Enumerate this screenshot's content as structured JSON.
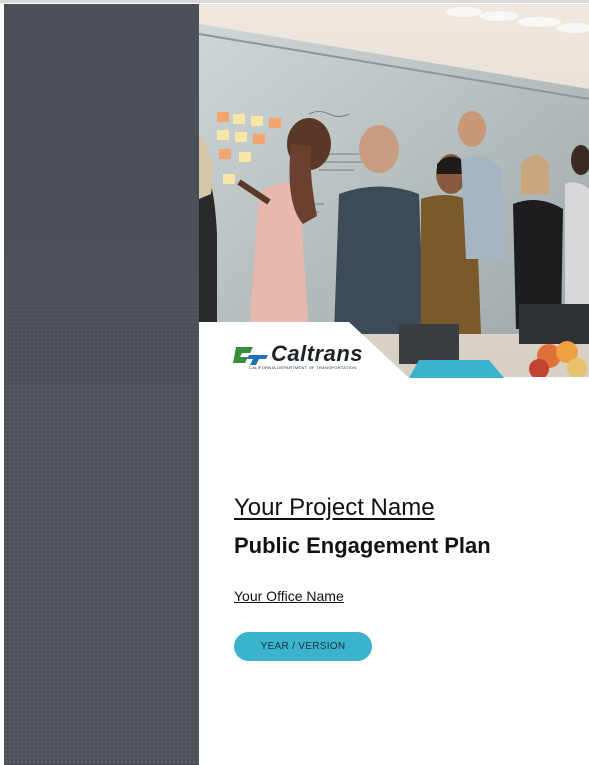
{
  "cover": {
    "project_name": "Your Project Name",
    "plan_title": "Public Engagement Plan",
    "office_name": "Your Office Name",
    "year_version_label": "YEAR / VERSION"
  },
  "logo": {
    "wordmark": "Caltrans",
    "subtitle": "CALIFORNIA DEPARTMENT OF TRANSPORTATION"
  },
  "colors": {
    "left_band": "#4b5156",
    "accent": "#3bb3cf",
    "text": "#121212"
  },
  "photo": {
    "icon": "team-meeting-photo"
  }
}
